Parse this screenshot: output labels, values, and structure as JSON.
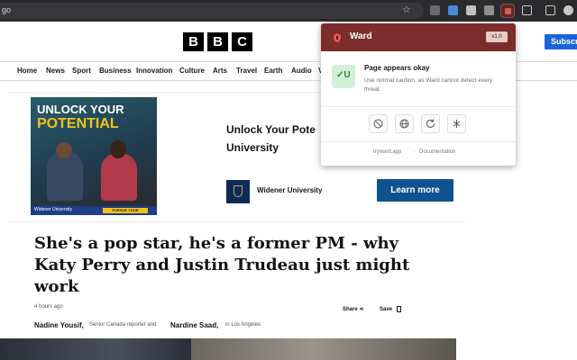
{
  "browser": {
    "address_text": "go",
    "star_icon": "star-icon"
  },
  "site": {
    "logo_letters": [
      "B",
      "B",
      "C"
    ],
    "subscribe_label": "Subscri",
    "nav": [
      "Home",
      "News",
      "Sport",
      "Business",
      "Innovation",
      "Culture",
      "Arts",
      "Travel",
      "Earth",
      "Audio",
      "V"
    ]
  },
  "ad": {
    "image_headline_line1": "UNLOCK YOUR",
    "image_headline_line2": "POTENTIAL",
    "image_footer_left": "Widener University",
    "image_footer_button": "PURSUE YOUR PROGRAM",
    "title": "Unlock Your Pote University",
    "advertiser": "Widener University",
    "cta_label": "Learn more"
  },
  "article": {
    "headline": "She's a pop star, he's a former PM - why Katy Perry and Justin Trudeau just might work",
    "timestamp": "4 hours ago",
    "share_label": "Share",
    "save_label": "Save",
    "author1_name": "Nadine Yousif,",
    "author1_role": "Senior Canada reporter and",
    "author2_name": "Nardine Saad,",
    "author2_role": "in Los Angeles"
  },
  "ward_popup": {
    "title": "Ward",
    "version": "v1.0",
    "status_title": "Page appears okay",
    "status_description": "Use normal caution, as Ward cannot detect every threat.",
    "status_icon_text": "✓U",
    "tools": [
      "block-icon",
      "globe-icon",
      "refresh-icon",
      "bug-icon"
    ],
    "footer_link1": "tryward.app",
    "footer_separator": "·",
    "footer_link2": "Documentation"
  },
  "colors": {
    "chrome_bg": "#2b2b2e",
    "ward_header": "#7c2d2b",
    "bbc_black": "#000000",
    "subscribe_blue": "#1b64d8",
    "cta_blue": "#0f5290",
    "ok_green_bg": "#d2f0d8",
    "ok_green": "#1f8a3b"
  }
}
